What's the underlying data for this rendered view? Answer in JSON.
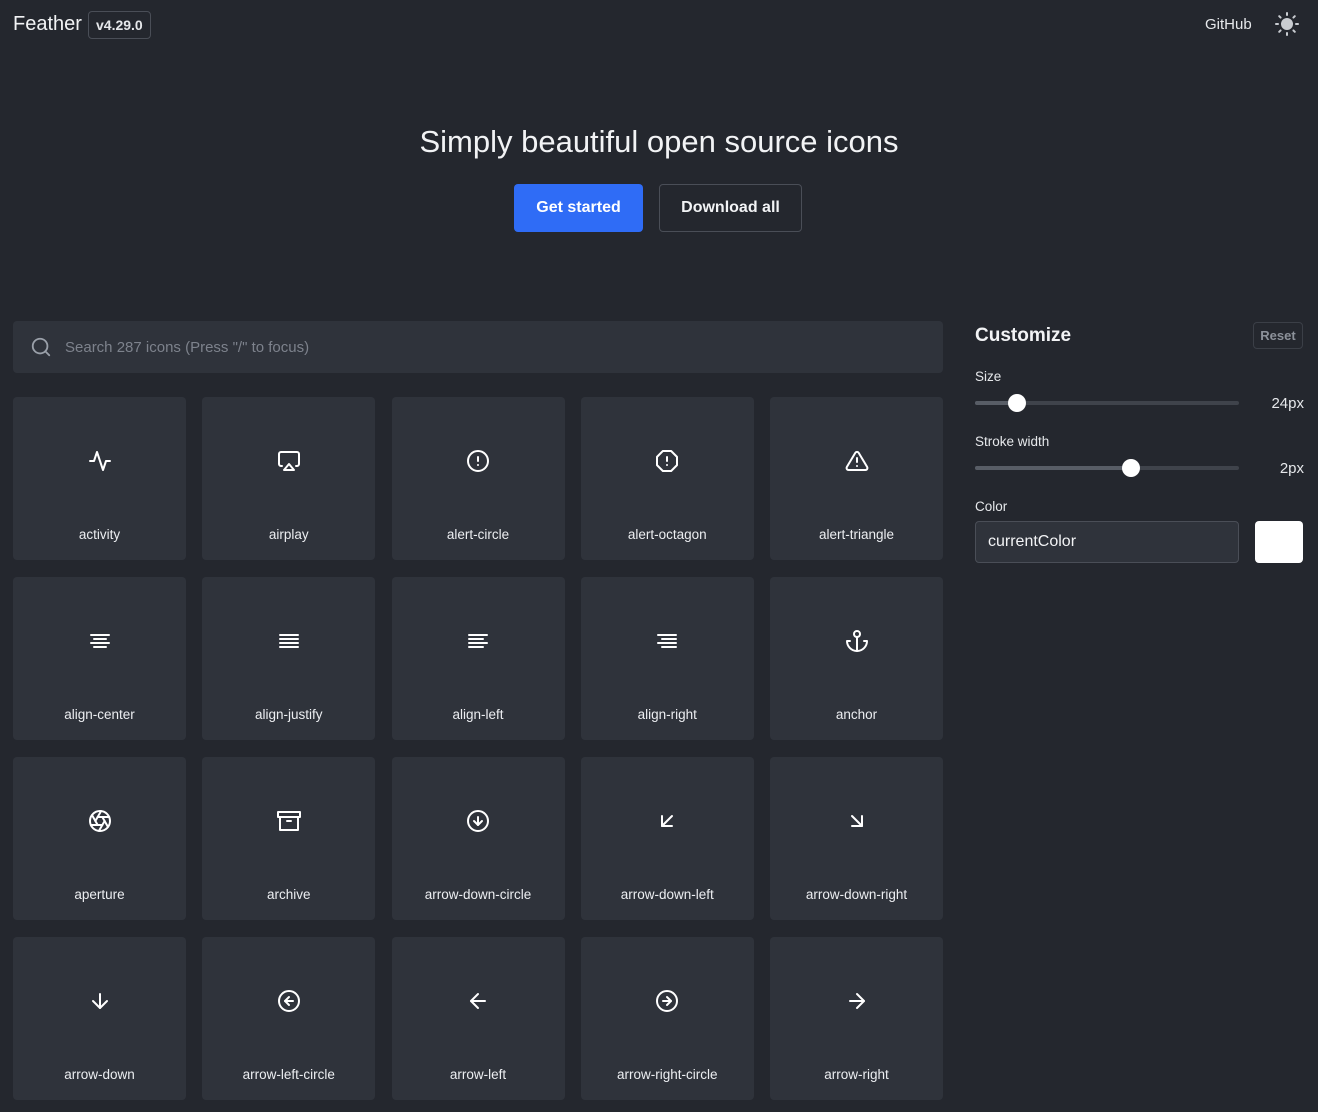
{
  "header": {
    "brand": "Feather",
    "version": "v4.29.0",
    "github": "GitHub",
    "theme_icon": "sun-icon"
  },
  "hero": {
    "title": "Simply beautiful open source icons",
    "primary_label": "Get started",
    "secondary_label": "Download all"
  },
  "search": {
    "placeholder": "Search 287 icons (Press \"/\" to focus)",
    "value": ""
  },
  "icons": [
    {
      "name": "activity",
      "icon": "activity-icon"
    },
    {
      "name": "airplay",
      "icon": "airplay-icon"
    },
    {
      "name": "alert-circle",
      "icon": "alert-circle-icon"
    },
    {
      "name": "alert-octagon",
      "icon": "alert-octagon-icon"
    },
    {
      "name": "alert-triangle",
      "icon": "alert-triangle-icon"
    },
    {
      "name": "align-center",
      "icon": "align-center-icon"
    },
    {
      "name": "align-justify",
      "icon": "align-justify-icon"
    },
    {
      "name": "align-left",
      "icon": "align-left-icon"
    },
    {
      "name": "align-right",
      "icon": "align-right-icon"
    },
    {
      "name": "anchor",
      "icon": "anchor-icon"
    },
    {
      "name": "aperture",
      "icon": "aperture-icon"
    },
    {
      "name": "archive",
      "icon": "archive-icon"
    },
    {
      "name": "arrow-down-circle",
      "icon": "arrow-down-circle-icon"
    },
    {
      "name": "arrow-down-left",
      "icon": "arrow-down-left-icon"
    },
    {
      "name": "arrow-down-right",
      "icon": "arrow-down-right-icon"
    },
    {
      "name": "arrow-down",
      "icon": "arrow-down-icon"
    },
    {
      "name": "arrow-left-circle",
      "icon": "arrow-left-circle-icon"
    },
    {
      "name": "arrow-left",
      "icon": "arrow-left-icon"
    },
    {
      "name": "arrow-right-circle",
      "icon": "arrow-right-circle-icon"
    },
    {
      "name": "arrow-right",
      "icon": "arrow-right-icon"
    }
  ],
  "customize": {
    "title": "Customize",
    "reset_label": "Reset",
    "size": {
      "label": "Size",
      "value": "24px",
      "fraction": 0.16
    },
    "stroke": {
      "label": "Stroke width",
      "value": "2px",
      "fraction": 0.59
    },
    "color": {
      "label": "Color",
      "value": "currentColor",
      "swatch": "#ffffff"
    }
  },
  "colors": {
    "background": "#24272e",
    "tile": "#2f333b",
    "accent": "#2f6cf6",
    "text": "#e6e8eb"
  }
}
